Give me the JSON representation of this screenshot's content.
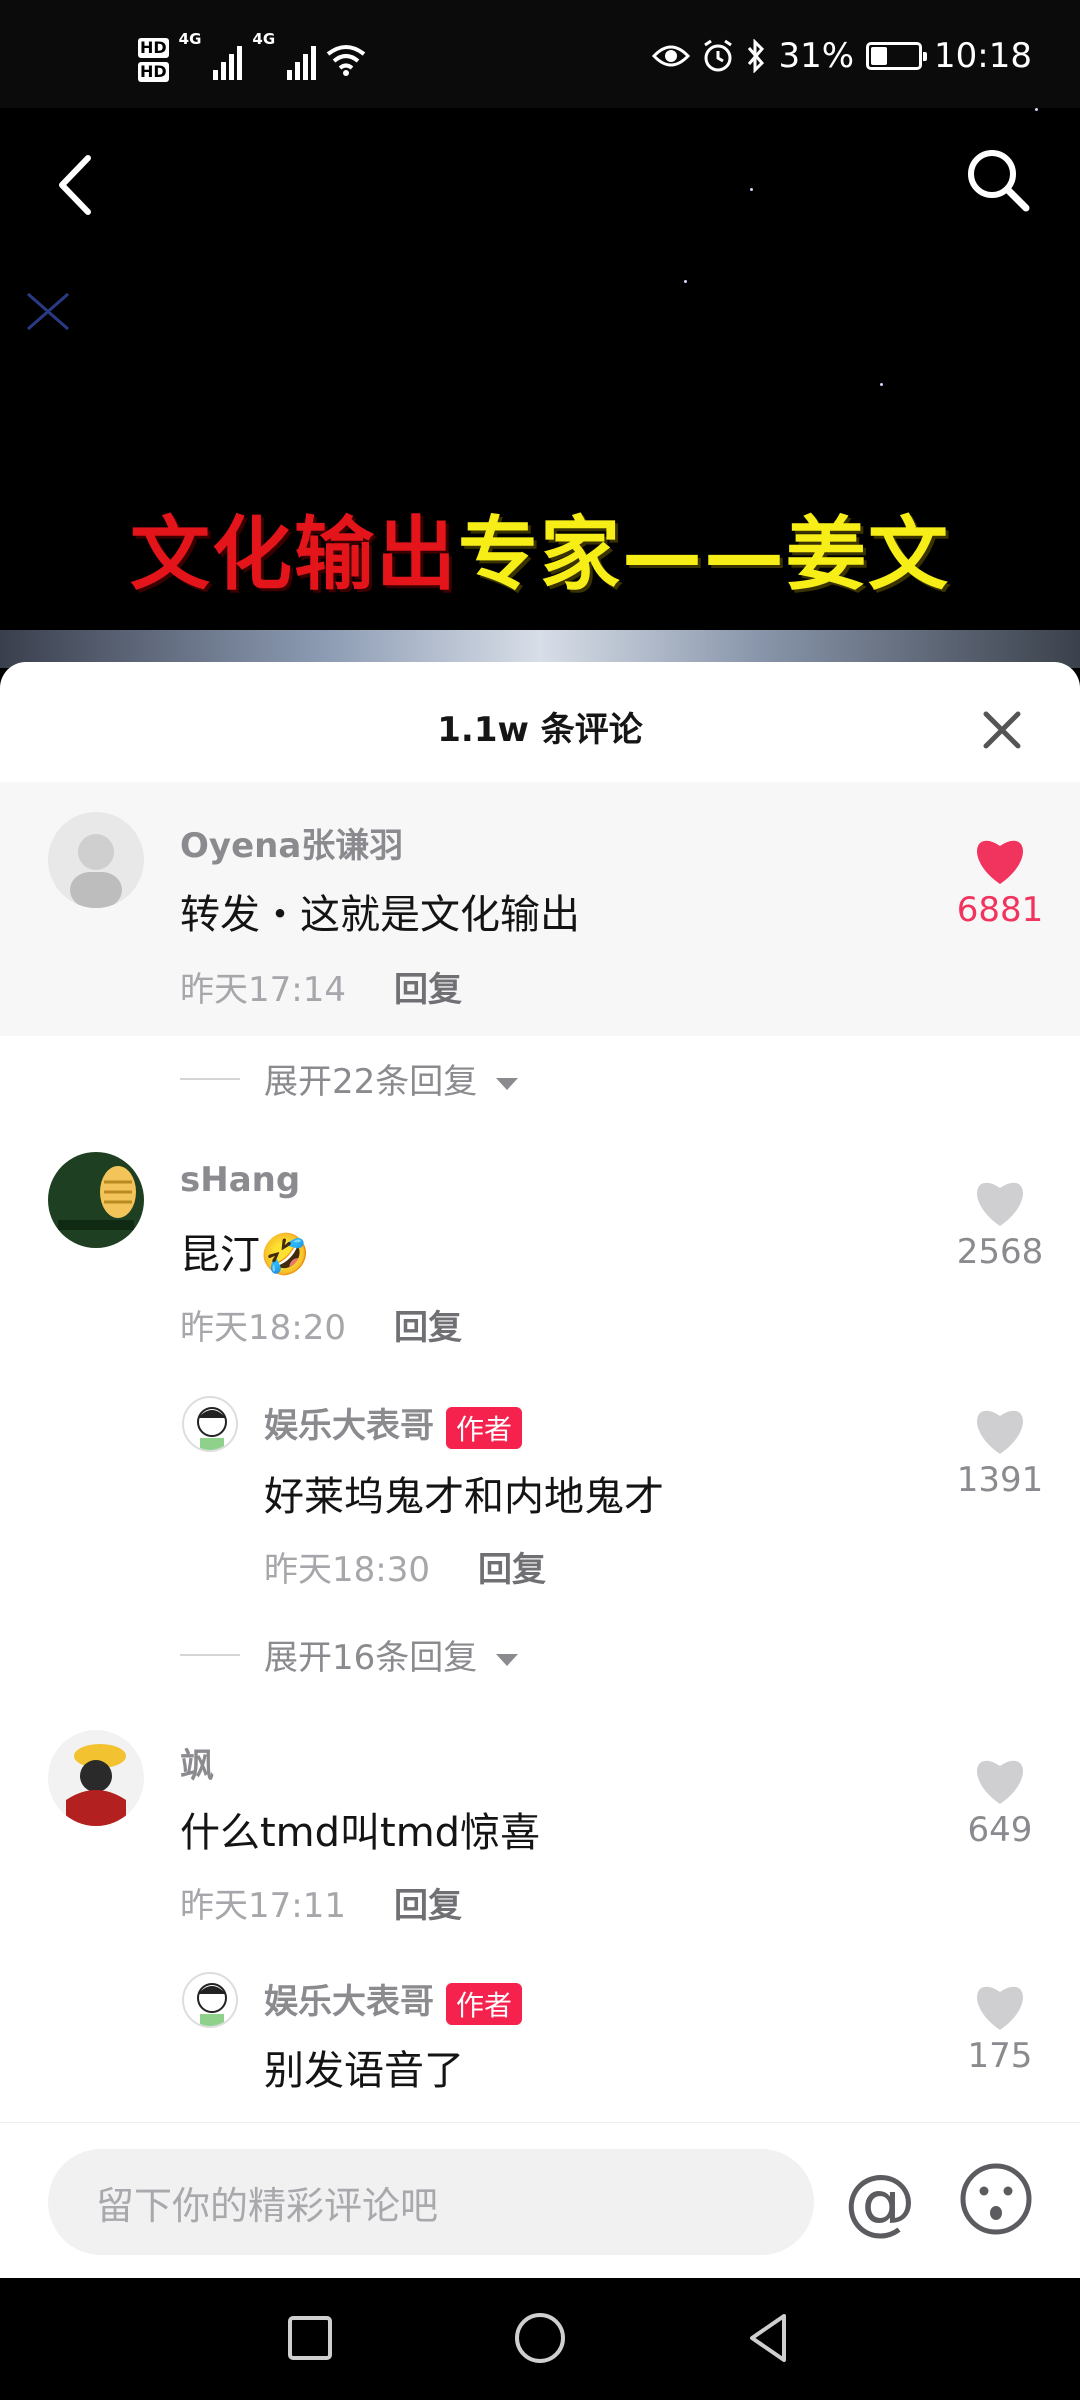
{
  "status_bar": {
    "hd1": "HD",
    "hd2": "HD",
    "sim1_net": "4G",
    "sim2_net": "4G",
    "battery": "31%",
    "time": "10:18",
    "icons": [
      "eye-icon",
      "alarm-icon",
      "bluetooth-icon",
      "wifi-icon"
    ]
  },
  "video": {
    "headline_part1": "文化输出",
    "headline_part2": "专家——姜文",
    "headline_colors": {
      "part1": "#e3141a",
      "part2": "#f7ee18"
    }
  },
  "comments_sheet": {
    "title": "1.1w 条评论",
    "comments": [
      {
        "user": "Oyena张谦羽",
        "text": "转发・这就是文化输出",
        "time": "昨天17:14",
        "reply": "回复",
        "likes": "6881",
        "liked": true
      },
      {
        "user": "sHang",
        "text": "昆汀",
        "emoji": "🤣",
        "time": "昨天18:20",
        "reply": "回复",
        "likes": "2568",
        "liked": false
      },
      {
        "user": "娱乐大表哥",
        "tag": "作者",
        "text": "好莱坞鬼才和内地鬼才",
        "time": "昨天18:30",
        "reply": "回复",
        "likes": "1391",
        "liked": false
      },
      {
        "user": "飒",
        "text": "什么tmd叫tmd惊喜",
        "time": "昨天17:11",
        "reply": "回复",
        "likes": "649",
        "liked": false
      },
      {
        "user": "娱乐大表哥",
        "tag": "作者",
        "text": "别发语音了",
        "likes": "175",
        "liked": false
      }
    ],
    "expand_1": "展开22条回复",
    "expand_2": "展开16条回复"
  },
  "input": {
    "placeholder": "留下你的精彩评论吧",
    "at_label": "@"
  },
  "colors": {
    "like_active": "#f0345e",
    "author_tag": "#f5224d"
  }
}
